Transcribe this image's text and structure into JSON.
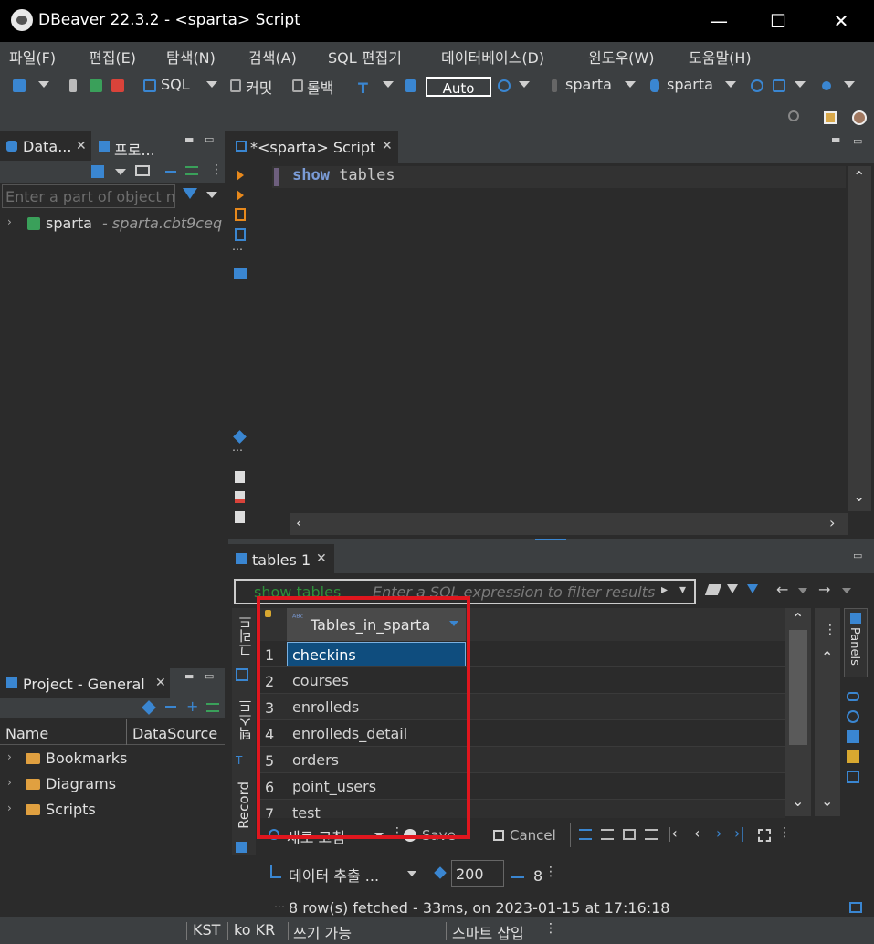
{
  "window": {
    "title": "DBeaver 22.3.2 - <sparta> Script",
    "minimize": "—",
    "maximize": "☐",
    "close": "✕"
  },
  "menu": [
    "파일(F)",
    "편집(E)",
    "탐색(N)",
    "검색(A)",
    "SQL 편집기",
    "데이터베이스(D)",
    "윈도우(W)",
    "도움말(H)"
  ],
  "toolbar": {
    "sql_label": "SQL",
    "commit_label": "커밋",
    "rollback_label": "롤백",
    "tx_mode": "Auto",
    "datasource": "sparta",
    "schema": "sparta"
  },
  "navigator": {
    "tab_label": "Data...",
    "tab2_label": "프로...",
    "filter_placeholder": "Enter a part of object n",
    "tree": [
      {
        "label": "sparta",
        "detail": "- sparta.cbt9ceq"
      }
    ]
  },
  "project": {
    "tab_label": "Project - General",
    "columns": [
      "Name",
      "DataSource"
    ],
    "items": [
      "Bookmarks",
      "Diagrams",
      "Scripts"
    ]
  },
  "editor": {
    "tab_label": "*<sparta> Script",
    "code_keyword": "show",
    "code_rest": " tables"
  },
  "results": {
    "tab_label": "tables 1",
    "query_label": "show tables",
    "filter_placeholder": "Enter a SQL expression to filter results",
    "column": "Tables_in_sparta",
    "rows": [
      "checkins",
      "courses",
      "enrolleds",
      "enrolleds_detail",
      "orders",
      "point_users",
      "test"
    ],
    "side_tabs": {
      "grid": "그리드",
      "text": "텍스트",
      "record": "Record"
    },
    "panels_label": "Panels",
    "refresh_label": "새로 고침",
    "save_label": "Save",
    "cancel_label": "Cancel",
    "export_label": "데이터 추출 ...",
    "fetch_size": "200",
    "row_count": "8",
    "status_text": "8 row(s) fetched - 33ms, on 2023-01-15 at 17:16:18"
  },
  "statusbar": {
    "timezone": "KST",
    "locale": "ko KR",
    "mode": "쓰기 가능",
    "insert": "스마트 삽입"
  },
  "colors": {
    "highlight": "#e0161e",
    "selection": "#0f4d7e",
    "keyword": "#7a9bd6"
  }
}
